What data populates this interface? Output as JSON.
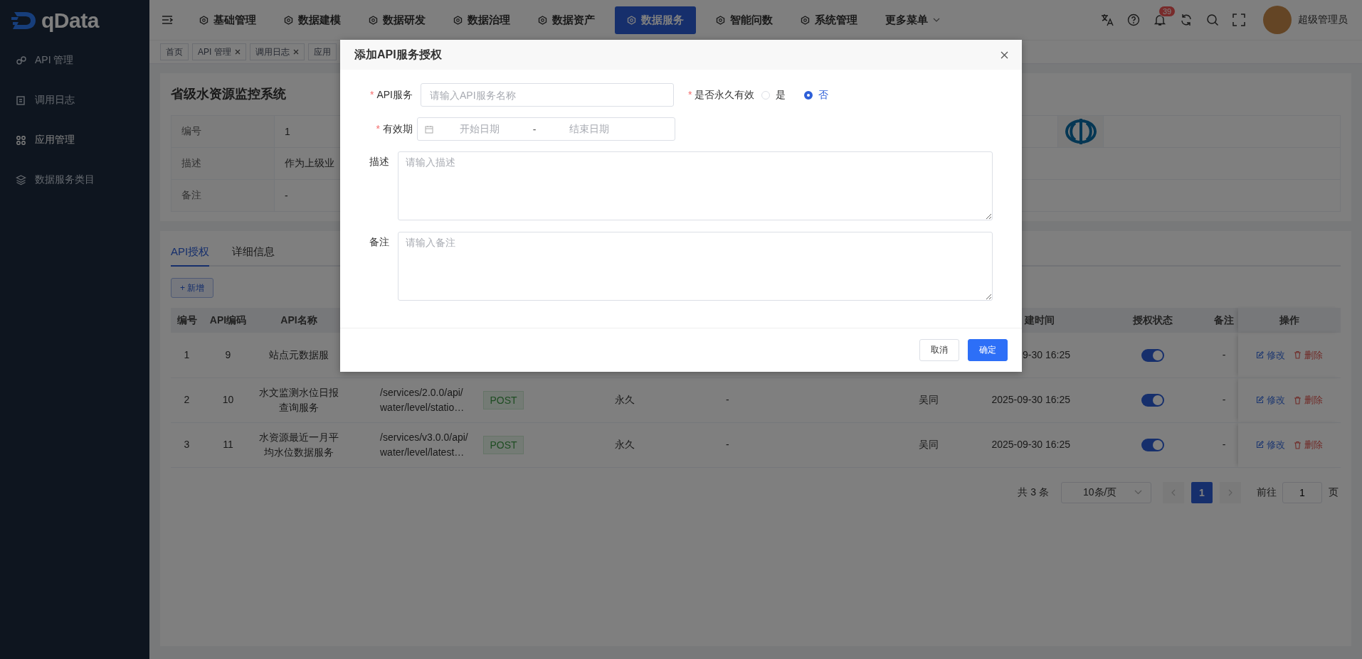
{
  "sidebar": {
    "logo": "qData",
    "items": [
      {
        "label": "API 管理",
        "selected": false
      },
      {
        "label": "调用日志",
        "selected": false
      },
      {
        "label": "应用管理",
        "selected": true
      },
      {
        "label": "数据服务类目",
        "selected": false
      }
    ]
  },
  "topbar": {
    "nav": [
      {
        "label": "基础管理",
        "selected": false,
        "kind": "link"
      },
      {
        "label": "数据建模",
        "selected": false,
        "kind": "link"
      },
      {
        "label": "数据研发",
        "selected": false,
        "kind": "link"
      },
      {
        "label": "数据治理",
        "selected": false,
        "kind": "link"
      },
      {
        "label": "数据资产",
        "selected": false,
        "kind": "link"
      },
      {
        "label": "数据服务",
        "selected": true,
        "kind": "link"
      },
      {
        "label": "智能问数",
        "selected": false,
        "kind": "link"
      },
      {
        "label": "系统管理",
        "selected": false,
        "kind": "link"
      },
      {
        "label": "更多菜单",
        "selected": false,
        "kind": "dropdown"
      }
    ],
    "notification_count": "39",
    "user": "超级管理员"
  },
  "page_tabs": [
    {
      "label": "首页",
      "closable": false
    },
    {
      "label": "API 管理",
      "closable": true
    },
    {
      "label": "调用日志",
      "closable": true
    },
    {
      "label": "应用",
      "closable": false
    }
  ],
  "detail": {
    "title": "省级水资源监控系统",
    "rows": [
      {
        "label": "编号",
        "value": "1"
      },
      {
        "label": "描述",
        "value": "作为上级业"
      },
      {
        "label": "备注",
        "value": "-"
      }
    ]
  },
  "content_tabs": [
    {
      "label": "API授权",
      "selected": true
    },
    {
      "label": "详细信息",
      "selected": false
    }
  ],
  "add_button": "+ 新增",
  "table": {
    "columns": {
      "id": "编号",
      "api_code": "API编码",
      "api_name": "API名称",
      "created": "建时间",
      "authorized": "授权状态",
      "remark": "备注",
      "actions": "操作"
    },
    "rows": [
      {
        "id": "1",
        "api_code": "9",
        "api_name": "站点元数据服",
        "created": "9-30 16:25",
        "authorized": true,
        "remark": "-",
        "actions": [
          {
            "label": "修改",
            "kind": "edit"
          },
          {
            "label": "删除",
            "kind": "delete"
          }
        ]
      },
      {
        "id": "2",
        "api_code": "10",
        "api_name": "水文监测水位日报查询服务",
        "column_4": "/services/2.0.0/api/\nwater/level/statio…",
        "column_5": "POST",
        "column_6": "永久",
        "column_7": "-",
        "column_8": "吴同",
        "created": "2025-09-30 16:25",
        "authorized": true,
        "remark": "-",
        "actions": [
          {
            "label": "修改",
            "kind": "edit"
          },
          {
            "label": "删除",
            "kind": "delete"
          }
        ]
      },
      {
        "id": "3",
        "api_code": "11",
        "api_name": "水资源最近一月平均水位数据服务",
        "column_4": "/services/v3.0.0/api/\nwater/level/latest…",
        "column_5": "POST",
        "column_6": "永久",
        "column_7": "-",
        "column_8": "吴同",
        "created": "2025-09-30 16:25",
        "authorized": true,
        "remark": "-",
        "actions": [
          {
            "label": "修改",
            "kind": "edit"
          },
          {
            "label": "删除",
            "kind": "delete"
          }
        ]
      }
    ]
  },
  "pagination": {
    "total": "共 3 条",
    "page_size": "10条/页",
    "pages": [
      {
        "label": "1",
        "selected": true
      }
    ],
    "goto_label": "前往",
    "goto_value": "1",
    "page_suffix": "页"
  },
  "modal": {
    "title": "添加API服务授权",
    "fields": [
      {
        "kind": "text",
        "label": "API服务",
        "required_mark": "*",
        "placeholder": "请输入API服务名称"
      },
      {
        "kind": "radio",
        "label": "是否永久有效",
        "required_mark": "*",
        "options": [
          {
            "label": "是",
            "selected": false
          },
          {
            "label": "否",
            "selected": true
          }
        ]
      },
      {
        "kind": "daterange",
        "label": "有效期",
        "required_mark": "*",
        "start_placeholder": "开始日期",
        "separator": "-",
        "end_placeholder": "结束日期"
      },
      {
        "kind": "textarea",
        "label": "描述",
        "placeholder": "请输入描述"
      },
      {
        "kind": "textarea",
        "label": "备注",
        "placeholder": "请输入备注"
      }
    ],
    "buttons": [
      {
        "label": "取消",
        "kind": "default"
      },
      {
        "label": "确定",
        "kind": "primary"
      }
    ]
  }
}
